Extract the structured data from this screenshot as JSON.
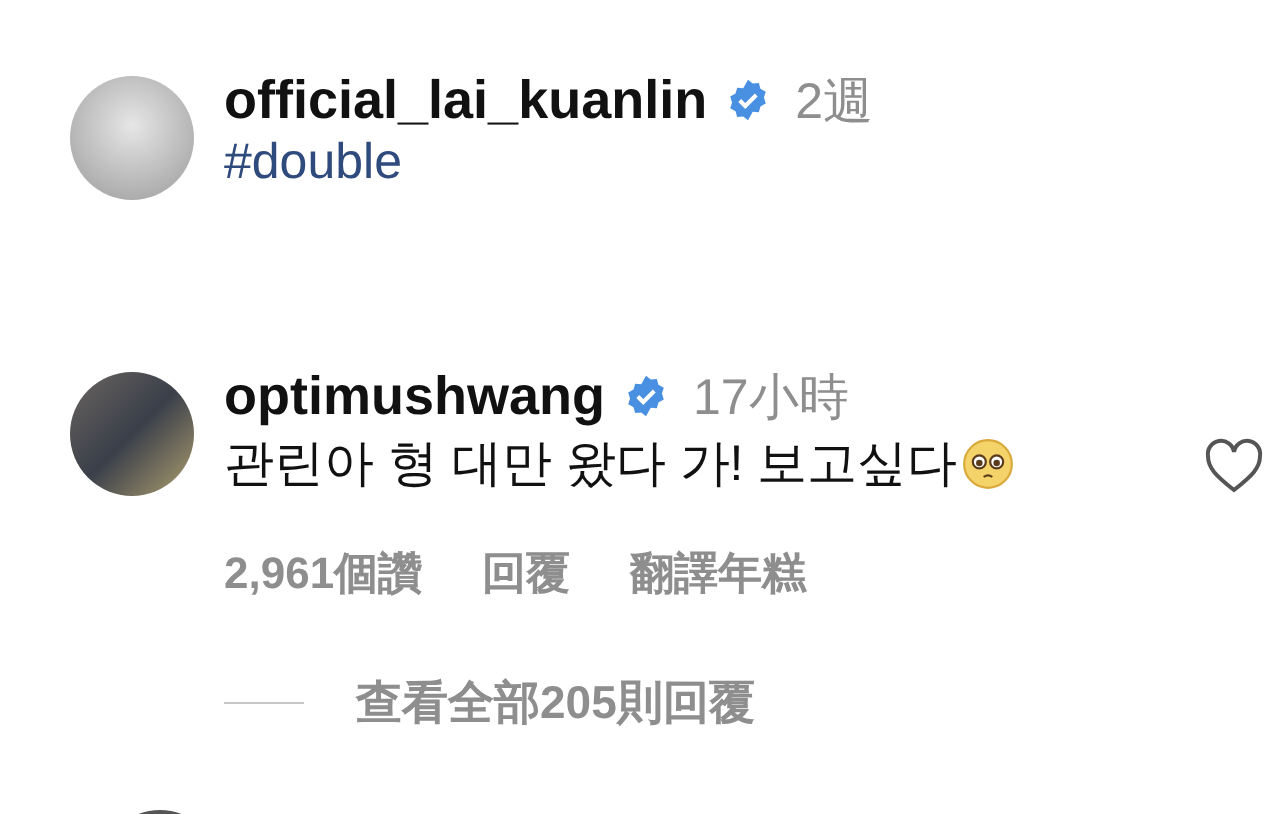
{
  "comments": [
    {
      "username": "official_lai_kuanlin",
      "verified": true,
      "time": "2週",
      "text": "#double",
      "kind": "hashtag",
      "emoji": false
    },
    {
      "username": "optimushwang",
      "verified": true,
      "time": "17小時",
      "text": "관린아 형 대만 왔다 가! 보고싶다",
      "kind": "plain",
      "emoji": true,
      "liked": false,
      "likes": "2,961個讚",
      "reply": "回覆",
      "translate": "翻譯年糕",
      "view_replies": "查看全部205則回覆"
    }
  ]
}
